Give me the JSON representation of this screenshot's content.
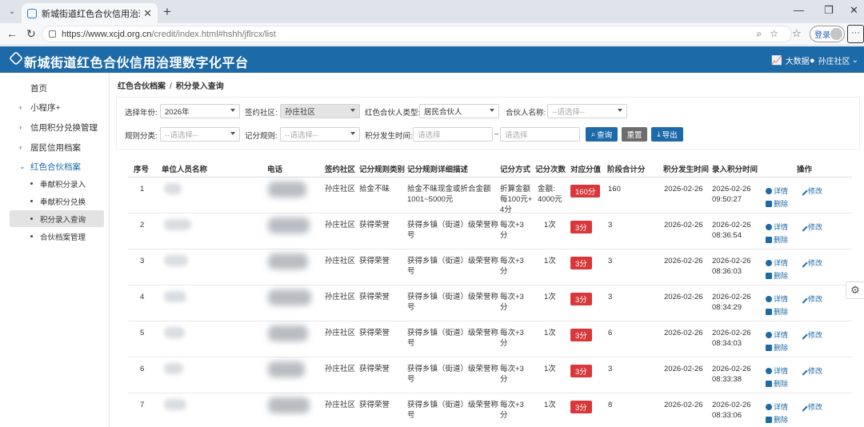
{
  "browser": {
    "tab_title": "新城街道红色合伙信用治理数字化",
    "url_host": "https://www.xcjd.org.cn",
    "url_path": "/credit/index.html#hshh/jflrcx/list",
    "login_label": "登录"
  },
  "header": {
    "title": "新城街道红色合伙信用治理数字化平台",
    "bigdata_label": "大数据",
    "user_label": "孙庄社区"
  },
  "sidebar": {
    "items": [
      {
        "label": "首页",
        "chevron": ""
      },
      {
        "label": "小程序+",
        "chevron": "›"
      },
      {
        "label": "信用积分兑换管理",
        "chevron": "›"
      },
      {
        "label": "居民信用档案",
        "chevron": "›"
      },
      {
        "label": "红色合伙档案",
        "chevron": "⌄"
      }
    ],
    "subitems": [
      {
        "label": "奉献积分录入"
      },
      {
        "label": "奉献积分兑换"
      },
      {
        "label": "积分录入查询"
      },
      {
        "label": "合伙档案管理"
      }
    ]
  },
  "breadcrumb": {
    "parent": "红色合伙档案",
    "separator": "/",
    "current": "积分录入查询"
  },
  "filters": {
    "year_label": "选择年份:",
    "year_value": "2026年",
    "community_label": "签约社区:",
    "community_value": "孙庄社区",
    "partner_type_label": "红色合伙人类型:",
    "partner_type_value": "居民合伙人",
    "partner_name_label": "合伙人名称:",
    "partner_name_placeholder": "--请选择--",
    "rule_category_label": "规则分类:",
    "rule_category_placeholder": "--请选择--",
    "rule_label": "记分规则:",
    "rule_placeholder": "--请选择--",
    "time_label": "积分发生时间:",
    "time_start_placeholder": "请选择",
    "time_dash": "–",
    "time_end_placeholder": "请选择",
    "query_button": "查询",
    "reset_button": "重置",
    "export_button": "导出"
  },
  "table": {
    "columns": [
      "序号",
      "单位人员名称",
      "电话",
      "签约社区",
      "记分规则类别",
      "记分规则详细描述",
      "记分方式",
      "记分次数",
      "对应分值",
      "阶段合计分",
      "积分发生时间",
      "录入积分时间",
      "操作"
    ],
    "detail_label": "详情",
    "delete_label": "删除",
    "edit_label": "修改",
    "rows": [
      {
        "no": "1",
        "community": "孙庄社区",
        "category": "拾金不昧",
        "desc": [
          "拾金不昧现金或折合金额",
          "1001~5000元"
        ],
        "method": [
          "折算金额",
          "每100元+",
          "4分"
        ],
        "count": [
          "金额:",
          "4000元"
        ],
        "points": "160分",
        "total": "160",
        "occur": "2026-02-26",
        "entry_date": "2026-02-26",
        "entry_time": "09:50:27"
      },
      {
        "no": "2",
        "community": "孙庄社区",
        "category": "获得荣誉",
        "desc": [
          "获得乡镇（街道）级荣誉称",
          "号"
        ],
        "method": [
          "每次+3",
          "分"
        ],
        "count": [
          "1次"
        ],
        "points": "3分",
        "total": "3",
        "occur": "2026-02-26",
        "entry_date": "2026-02-26",
        "entry_time": "08:36:54"
      },
      {
        "no": "3",
        "community": "孙庄社区",
        "category": "获得荣誉",
        "desc": [
          "获得乡镇（街道）级荣誉称",
          "号"
        ],
        "method": [
          "每次+3",
          "分"
        ],
        "count": [
          "1次"
        ],
        "points": "3分",
        "total": "3",
        "occur": "2026-02-26",
        "entry_date": "2026-02-26",
        "entry_time": "08:36:03"
      },
      {
        "no": "4",
        "community": "孙庄社区",
        "category": "获得荣誉",
        "desc": [
          "获得乡镇（街道）级荣誉称",
          "号"
        ],
        "method": [
          "每次+3",
          "分"
        ],
        "count": [
          "1次"
        ],
        "points": "3分",
        "total": "3",
        "occur": "2026-02-26",
        "entry_date": "2026-02-26",
        "entry_time": "08:34:29"
      },
      {
        "no": "5",
        "community": "孙庄社区",
        "category": "获得荣誉",
        "desc": [
          "获得乡镇（街道）级荣誉称",
          "号"
        ],
        "method": [
          "每次+3",
          "分"
        ],
        "count": [
          "1次"
        ],
        "points": "3分",
        "total": "6",
        "occur": "2026-02-26",
        "entry_date": "2026-02-26",
        "entry_time": "08:34:03"
      },
      {
        "no": "6",
        "community": "孙庄社区",
        "category": "获得荣誉",
        "desc": [
          "获得乡镇（街道）级荣誉称",
          "号"
        ],
        "method": [
          "每次+3",
          "分"
        ],
        "count": [
          "1次"
        ],
        "points": "3分",
        "total": "3",
        "occur": "2026-02-26",
        "entry_date": "2026-02-26",
        "entry_time": "08:33:38"
      },
      {
        "no": "7",
        "community": "孙庄社区",
        "category": "获得荣誉",
        "desc": [
          "获得乡镇（街道）级荣誉称",
          "号"
        ],
        "method": [
          "每次+3",
          "分"
        ],
        "count": [
          "1次"
        ],
        "points": "3分",
        "total": "8",
        "occur": "2026-02-26",
        "entry_date": "2026-02-26",
        "entry_time": "08:33:06"
      }
    ]
  }
}
